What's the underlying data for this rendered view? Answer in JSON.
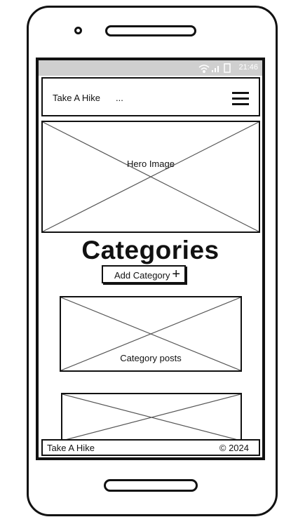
{
  "status_bar": {
    "time": "21:46",
    "wifi_icon": "wifi-icon",
    "signal_icon": "signal-icon",
    "battery_icon": "battery-icon"
  },
  "navbar": {
    "brand": "Take A Hike",
    "extra": "...",
    "menu_icon": "hamburger-menu-icon"
  },
  "hero": {
    "label": "Hero Image"
  },
  "main": {
    "title": "Categories",
    "add_button_label": "Add Category",
    "add_icon": "plus-icon",
    "cards": [
      {
        "label": "Category posts"
      },
      {
        "label": ""
      }
    ]
  },
  "footer": {
    "brand": "Take A Hike",
    "copyright": "© 2024"
  }
}
